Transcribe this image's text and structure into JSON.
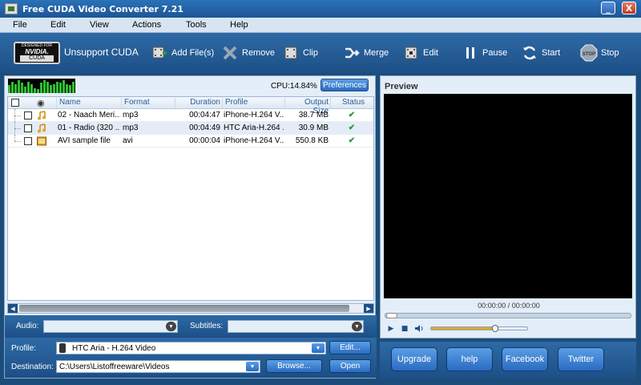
{
  "window": {
    "title": "Free CUDA Video Converter 7.21",
    "minimize": "_",
    "close": "X"
  },
  "menu": [
    "File",
    "Edit",
    "View",
    "Actions",
    "Tools",
    "Help"
  ],
  "toolbar": {
    "badge_line1": "DESIGNED FOR",
    "badge_line2": "NVIDIA.",
    "badge_line3": "CUDA",
    "unsupport": "Unsupport CUDA",
    "buttons": [
      "Add File(s)",
      "Remove",
      "Clip",
      "Merge",
      "Edit",
      "Pause",
      "Start",
      "Stop"
    ]
  },
  "status": {
    "cpu": "CPU:14.84%",
    "preferences": "Preferences",
    "cpu_levels": [
      0.6,
      0.9,
      0.7,
      1,
      0.8,
      0.5,
      0.9,
      0.7,
      0.4,
      0.3,
      0.8,
      1,
      0.9,
      0.6,
      0.7,
      0.9,
      0.8,
      1,
      0.7,
      0.6,
      0.9
    ]
  },
  "table": {
    "headers": [
      "Name",
      "Format",
      "Duration",
      "Profile",
      "Output Size",
      "Status"
    ],
    "rows": [
      {
        "name": "02 - Naach Meri...",
        "format": "mp3",
        "duration": "00:04:47",
        "profile": "iPhone-H.264 V...",
        "size": "38.7 MB",
        "status": "✔"
      },
      {
        "name": "01 - Radio (320 ...",
        "format": "mp3",
        "duration": "00:04:49",
        "profile": "HTC Aria-H.264 ...",
        "size": "30.9 MB",
        "status": "✔"
      },
      {
        "name": "AVI sample file",
        "format": "avi",
        "duration": "00:00:04",
        "profile": "iPhone-H.264 V...",
        "size": "550.8 KB",
        "status": "✔"
      }
    ]
  },
  "audio": {
    "label": "Audio:",
    "value": ""
  },
  "subtitles": {
    "label": "Subtitles:",
    "value": ""
  },
  "profile": {
    "label": "Profile:",
    "value": "HTC Aria - H.264 Video",
    "edit": "Edit..."
  },
  "destination": {
    "label": "Destination:",
    "value": "C:\\Users\\Listoffreeware\\Videos",
    "browse": "Browse...",
    "open": "Open"
  },
  "preview": {
    "title": "Preview",
    "time": "00:00:00 / 00:00:00",
    "volume": 0.7
  },
  "bottom_buttons": [
    "Upgrade",
    "help",
    "Facebook",
    "Twitter"
  ]
}
